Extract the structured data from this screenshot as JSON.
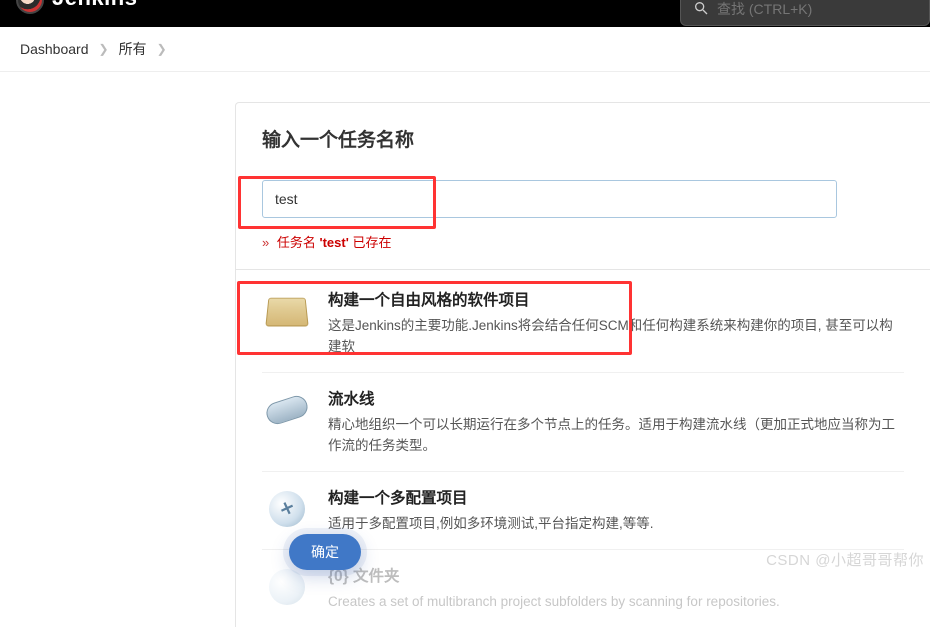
{
  "header": {
    "brand": "Jenkins",
    "search_placeholder": "查找 (CTRL+K)"
  },
  "breadcrumbs": {
    "items": [
      {
        "label": "Dashboard"
      },
      {
        "label": "所有"
      }
    ]
  },
  "page": {
    "title": "输入一个任务名称",
    "item_name_value": "test",
    "error_prefix": "任务名",
    "error_name": "'test'",
    "error_suffix": "已存在"
  },
  "types": [
    {
      "icon": "box-icon",
      "title": "构建一个自由风格的软件项目",
      "desc": "这是Jenkins的主要功能.Jenkins将会结合任何SCM和任何构建系统来构建你的项目, 甚至可以构建软"
    },
    {
      "icon": "pipeline-icon",
      "title": "流水线",
      "desc": "精心地组织一个可以长期运行在多个节点上的任务。适用于构建流水线（更加正式地应当称为工作流的任务类型。"
    },
    {
      "icon": "multi-config-icon",
      "title": "构建一个多配置项目",
      "desc": "适用于多配置项目,例如多环境测试,平台指定构建,等等."
    },
    {
      "icon": "folder-icon",
      "title": "{0} 文件夹",
      "desc": "Creates a set of multibranch project subfolders by scanning for repositories."
    }
  ],
  "ok_label": "确定",
  "watermark": "CSDN @小超哥哥帮你"
}
